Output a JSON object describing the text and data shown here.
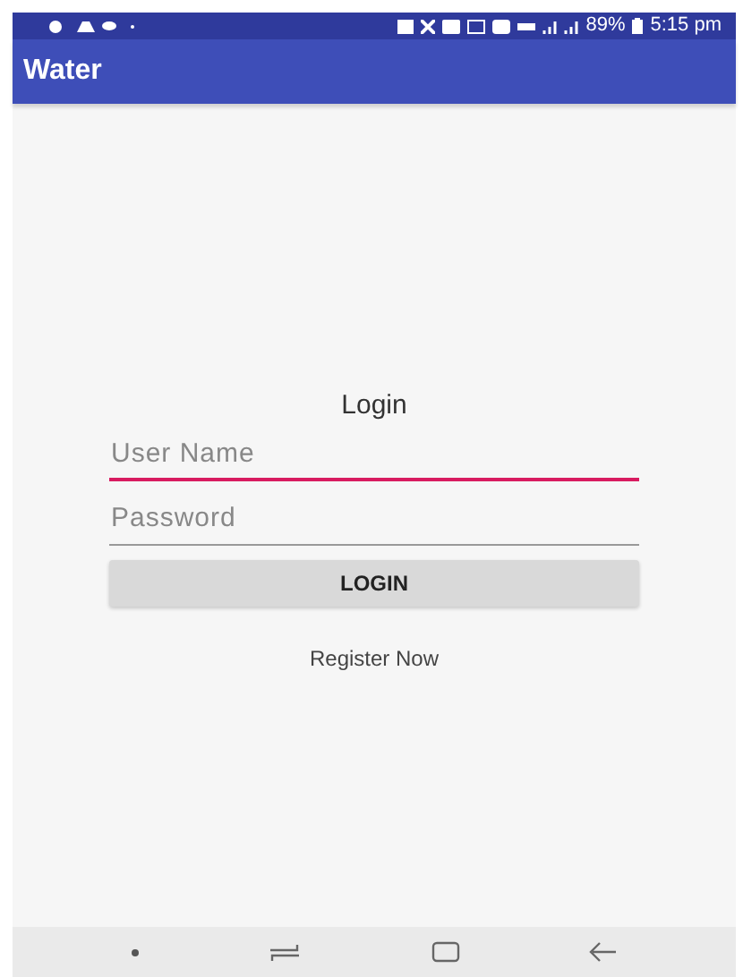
{
  "status_bar": {
    "battery": "89%",
    "time": "5:15 pm"
  },
  "app_bar": {
    "title": "Water"
  },
  "login": {
    "heading": "Login",
    "fields": [
      {
        "placeholder": "User Name",
        "focused": true
      },
      {
        "placeholder": "Password",
        "focused": false
      }
    ],
    "button": "LOGIN",
    "link": "Register Now"
  }
}
